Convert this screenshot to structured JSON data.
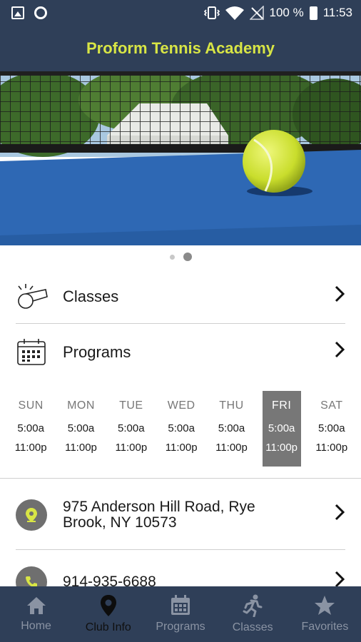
{
  "status_bar": {
    "battery": "100 %",
    "time": "11:53",
    "icons": [
      "image-icon",
      "circle-icon",
      "vibrate-icon",
      "wifi-icon",
      "no-signal-icon",
      "battery-icon"
    ]
  },
  "header": {
    "title": "Proform Tennis Academy"
  },
  "hero": {
    "image": "tennis-ball-on-blue-court",
    "slide_count": 2,
    "active_slide": 2
  },
  "menu": {
    "classes": {
      "label": "Classes",
      "icon": "whistle-icon"
    },
    "programs": {
      "label": "Programs",
      "icon": "calendar-icon"
    }
  },
  "hours": [
    {
      "day": "SUN",
      "open": "5:00a",
      "close": "11:00p",
      "active": false
    },
    {
      "day": "MON",
      "open": "5:00a",
      "close": "11:00p",
      "active": false
    },
    {
      "day": "TUE",
      "open": "5:00a",
      "close": "11:00p",
      "active": false
    },
    {
      "day": "WED",
      "open": "5:00a",
      "close": "11:00p",
      "active": false
    },
    {
      "day": "THU",
      "open": "5:00a",
      "close": "11:00p",
      "active": false
    },
    {
      "day": "FRI",
      "open": "5:00a",
      "close": "11:00p",
      "active": true
    },
    {
      "day": "SAT",
      "open": "5:00a",
      "close": "11:00p",
      "active": false
    }
  ],
  "contact": {
    "address_line1": "975 Anderson Hill Road, Rye",
    "address_line2": "Brook, NY 10573",
    "phone": "914-935-6688"
  },
  "bottom_nav": [
    {
      "label": "Home",
      "icon": "home-icon",
      "active": false
    },
    {
      "label": "Club Info",
      "icon": "location-pin-icon",
      "active": true
    },
    {
      "label": "Programs",
      "icon": "calendar-icon",
      "active": false
    },
    {
      "label": "Classes",
      "icon": "runner-icon",
      "active": false
    },
    {
      "label": "Favorites",
      "icon": "star-icon",
      "active": false
    }
  ],
  "colors": {
    "header_bg": "#2f3f58",
    "title_accent": "#d8e545",
    "active_day_bg": "#777777"
  }
}
